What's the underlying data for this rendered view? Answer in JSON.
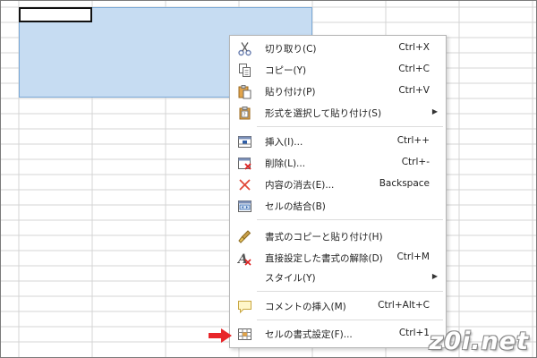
{
  "menu": {
    "items": [
      {
        "label": "切り取り(C)",
        "shortcut": "Ctrl+X",
        "icon": "scissors-icon"
      },
      {
        "label": "コピー(Y)",
        "shortcut": "Ctrl+C",
        "icon": "copy-icon"
      },
      {
        "label": "貼り付け(P)",
        "shortcut": "Ctrl+V",
        "icon": "paste-icon"
      },
      {
        "label": "形式を選択して貼り付け(S)",
        "shortcut": "",
        "icon": "paste-special-icon",
        "submenu": true
      },
      {
        "label": "挿入(I)...",
        "shortcut": "Ctrl++",
        "icon": "insert-cells-icon"
      },
      {
        "label": "削除(L)...",
        "shortcut": "Ctrl+-",
        "icon": "delete-cells-icon"
      },
      {
        "label": "内容の消去(E)...",
        "shortcut": "Backspace",
        "icon": "clear-contents-icon"
      },
      {
        "label": "セルの結合(B)",
        "shortcut": "",
        "icon": "merge-cells-icon"
      },
      {
        "label": "書式のコピーと貼り付け(H)",
        "shortcut": "",
        "icon": "clone-formatting-icon"
      },
      {
        "label": "直接設定した書式の解除(D)",
        "shortcut": "Ctrl+M",
        "icon": "clear-formatting-icon"
      },
      {
        "label": "スタイル(Y)",
        "shortcut": "",
        "icon": "",
        "submenu": true
      },
      {
        "label": "コメントの挿入(M)",
        "shortcut": "Ctrl+Alt+C",
        "icon": "comment-icon"
      },
      {
        "label": "セルの書式設定(F)...",
        "shortcut": "Ctrl+1",
        "icon": "format-cells-icon"
      }
    ]
  },
  "watermark": "z0i.net",
  "colors": {
    "selection": "#c6dcf2",
    "arrow": "#e8262a",
    "menu_border": "#b5b5b5"
  }
}
